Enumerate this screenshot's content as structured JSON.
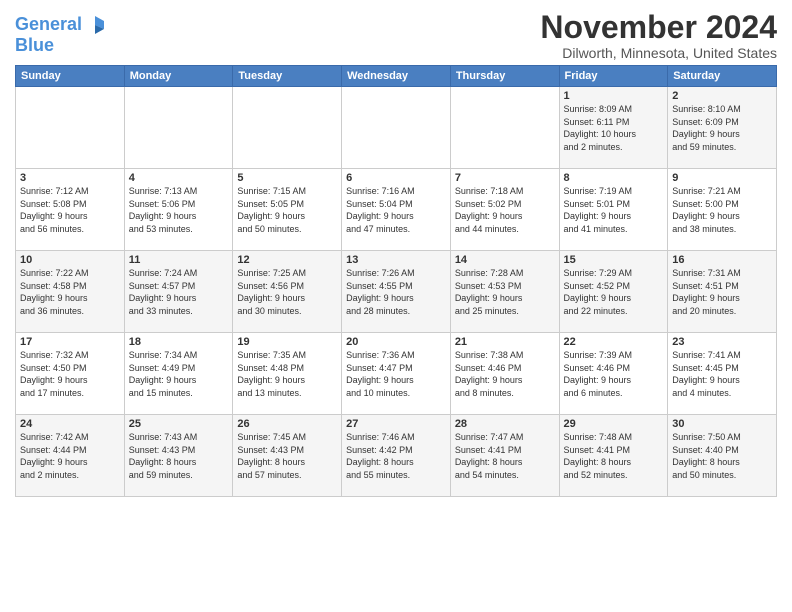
{
  "header": {
    "logo_line1": "General",
    "logo_line2": "Blue",
    "title": "November 2024",
    "subtitle": "Dilworth, Minnesota, United States"
  },
  "weekdays": [
    "Sunday",
    "Monday",
    "Tuesday",
    "Wednesday",
    "Thursday",
    "Friday",
    "Saturday"
  ],
  "weeks": [
    [
      {
        "day": "",
        "info": ""
      },
      {
        "day": "",
        "info": ""
      },
      {
        "day": "",
        "info": ""
      },
      {
        "day": "",
        "info": ""
      },
      {
        "day": "",
        "info": ""
      },
      {
        "day": "1",
        "info": "Sunrise: 8:09 AM\nSunset: 6:11 PM\nDaylight: 10 hours\nand 2 minutes."
      },
      {
        "day": "2",
        "info": "Sunrise: 8:10 AM\nSunset: 6:09 PM\nDaylight: 9 hours\nand 59 minutes."
      }
    ],
    [
      {
        "day": "3",
        "info": "Sunrise: 7:12 AM\nSunset: 5:08 PM\nDaylight: 9 hours\nand 56 minutes."
      },
      {
        "day": "4",
        "info": "Sunrise: 7:13 AM\nSunset: 5:06 PM\nDaylight: 9 hours\nand 53 minutes."
      },
      {
        "day": "5",
        "info": "Sunrise: 7:15 AM\nSunset: 5:05 PM\nDaylight: 9 hours\nand 50 minutes."
      },
      {
        "day": "6",
        "info": "Sunrise: 7:16 AM\nSunset: 5:04 PM\nDaylight: 9 hours\nand 47 minutes."
      },
      {
        "day": "7",
        "info": "Sunrise: 7:18 AM\nSunset: 5:02 PM\nDaylight: 9 hours\nand 44 minutes."
      },
      {
        "day": "8",
        "info": "Sunrise: 7:19 AM\nSunset: 5:01 PM\nDaylight: 9 hours\nand 41 minutes."
      },
      {
        "day": "9",
        "info": "Sunrise: 7:21 AM\nSunset: 5:00 PM\nDaylight: 9 hours\nand 38 minutes."
      }
    ],
    [
      {
        "day": "10",
        "info": "Sunrise: 7:22 AM\nSunset: 4:58 PM\nDaylight: 9 hours\nand 36 minutes."
      },
      {
        "day": "11",
        "info": "Sunrise: 7:24 AM\nSunset: 4:57 PM\nDaylight: 9 hours\nand 33 minutes."
      },
      {
        "day": "12",
        "info": "Sunrise: 7:25 AM\nSunset: 4:56 PM\nDaylight: 9 hours\nand 30 minutes."
      },
      {
        "day": "13",
        "info": "Sunrise: 7:26 AM\nSunset: 4:55 PM\nDaylight: 9 hours\nand 28 minutes."
      },
      {
        "day": "14",
        "info": "Sunrise: 7:28 AM\nSunset: 4:53 PM\nDaylight: 9 hours\nand 25 minutes."
      },
      {
        "day": "15",
        "info": "Sunrise: 7:29 AM\nSunset: 4:52 PM\nDaylight: 9 hours\nand 22 minutes."
      },
      {
        "day": "16",
        "info": "Sunrise: 7:31 AM\nSunset: 4:51 PM\nDaylight: 9 hours\nand 20 minutes."
      }
    ],
    [
      {
        "day": "17",
        "info": "Sunrise: 7:32 AM\nSunset: 4:50 PM\nDaylight: 9 hours\nand 17 minutes."
      },
      {
        "day": "18",
        "info": "Sunrise: 7:34 AM\nSunset: 4:49 PM\nDaylight: 9 hours\nand 15 minutes."
      },
      {
        "day": "19",
        "info": "Sunrise: 7:35 AM\nSunset: 4:48 PM\nDaylight: 9 hours\nand 13 minutes."
      },
      {
        "day": "20",
        "info": "Sunrise: 7:36 AM\nSunset: 4:47 PM\nDaylight: 9 hours\nand 10 minutes."
      },
      {
        "day": "21",
        "info": "Sunrise: 7:38 AM\nSunset: 4:46 PM\nDaylight: 9 hours\nand 8 minutes."
      },
      {
        "day": "22",
        "info": "Sunrise: 7:39 AM\nSunset: 4:46 PM\nDaylight: 9 hours\nand 6 minutes."
      },
      {
        "day": "23",
        "info": "Sunrise: 7:41 AM\nSunset: 4:45 PM\nDaylight: 9 hours\nand 4 minutes."
      }
    ],
    [
      {
        "day": "24",
        "info": "Sunrise: 7:42 AM\nSunset: 4:44 PM\nDaylight: 9 hours\nand 2 minutes."
      },
      {
        "day": "25",
        "info": "Sunrise: 7:43 AM\nSunset: 4:43 PM\nDaylight: 8 hours\nand 59 minutes."
      },
      {
        "day": "26",
        "info": "Sunrise: 7:45 AM\nSunset: 4:43 PM\nDaylight: 8 hours\nand 57 minutes."
      },
      {
        "day": "27",
        "info": "Sunrise: 7:46 AM\nSunset: 4:42 PM\nDaylight: 8 hours\nand 55 minutes."
      },
      {
        "day": "28",
        "info": "Sunrise: 7:47 AM\nSunset: 4:41 PM\nDaylight: 8 hours\nand 54 minutes."
      },
      {
        "day": "29",
        "info": "Sunrise: 7:48 AM\nSunset: 4:41 PM\nDaylight: 8 hours\nand 52 minutes."
      },
      {
        "day": "30",
        "info": "Sunrise: 7:50 AM\nSunset: 4:40 PM\nDaylight: 8 hours\nand 50 minutes."
      }
    ]
  ]
}
